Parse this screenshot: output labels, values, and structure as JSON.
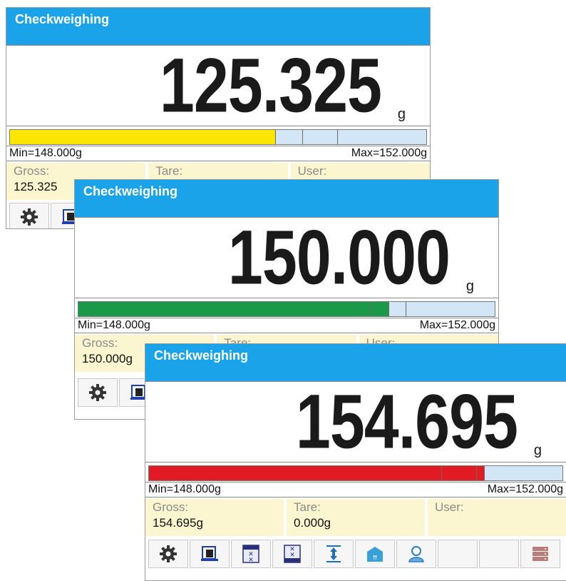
{
  "colors": {
    "title_bar": "#1aa3e8",
    "under": "#ffe600",
    "ok": "#1a9a48",
    "over": "#e11a24",
    "bar_bg": "#d3e6f6",
    "info_bg": "#fbf6cf"
  },
  "panels": [
    {
      "title": "Checkweighing",
      "weight": "125.325",
      "unit": "g",
      "bar_color": "under",
      "bar_fill_fraction": 0.66,
      "min_label": "Min=148.000g",
      "max_label": "Max=152.000g",
      "gross_label": "Gross:",
      "gross_value": "125.325",
      "tare_label": "Tare:",
      "tare_value": "",
      "user_label": "User:",
      "user_value": ""
    },
    {
      "title": "Checkweighing",
      "weight": "150.000",
      "unit": "g",
      "bar_color": "ok",
      "bar_fill_fraction": 0.74,
      "min_label": "Min=148.000g",
      "max_label": "Max=152.000g",
      "gross_label": "Gross:",
      "gross_value": "150.000g",
      "tare_label": "Tare:",
      "tare_value": "",
      "user_label": "User:",
      "user_value": ""
    },
    {
      "title": "Checkweighing",
      "weight": "154.695",
      "unit": "g",
      "bar_color": "over",
      "bar_fill_fraction": 0.81,
      "min_label": "Min=148.000g",
      "max_label": "Max=152.000g",
      "gross_label": "Gross:",
      "gross_value": "154.695g",
      "tare_label": "Tare:",
      "tare_value": "0.000g",
      "user_label": "User:",
      "user_value": ""
    }
  ],
  "buttons": [
    "gear-icon",
    "calibration-weight-icon",
    "set-thresholds-icon",
    "clear-thresholds-icon",
    "tare-icon",
    "product-icon",
    "user-icon",
    "blank",
    "blank",
    "database-icon"
  ]
}
